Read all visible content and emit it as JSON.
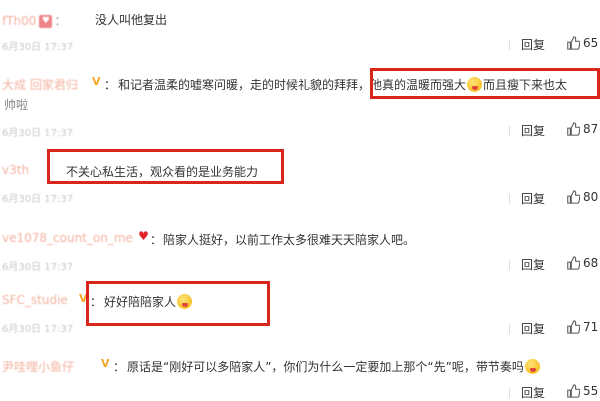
{
  "comments": [
    {
      "username": "fTh00",
      "badge": "♥",
      "text": "没人叫他复出",
      "timestamp": "6月30日 17:37",
      "reply_label": "回复",
      "likes": "65"
    },
    {
      "username": "大成 回家君归",
      "badge": "V",
      "text": "和记者温柔的嘘寒问暖，走的时候礼貌的拜拜，他真的温暖而强大",
      "text_after": "而且瘦下来也太",
      "text_line2": "帅啦",
      "timestamp": "6月30日 17:37",
      "reply_label": "回复",
      "likes": "87"
    },
    {
      "username": "v3th",
      "badge": "",
      "text": "不关心私生活，观众看的是业务能力",
      "timestamp": "6月30日 17:37",
      "reply_label": "回复",
      "likes": "80"
    },
    {
      "username": "ve1078_count_on_me",
      "badge": "♥",
      "text": "陪家人挺好，以前工作太多很难天天陪家人吧。",
      "timestamp": "6月30日 17:37",
      "reply_label": "回复",
      "likes": "68"
    },
    {
      "username": "SFC_studie",
      "badge": "V",
      "text": "好好陪陪家人",
      "timestamp": "6月30日 17:37",
      "reply_label": "回复",
      "likes": "71"
    },
    {
      "username": "尹哇哩小鱼仔",
      "badge": "V",
      "text": "原话是“刚好可以多陪家人”，你们为什么一定要加上那个“先”呢，带节奏吗",
      "timestamp": "",
      "reply_label": "回复",
      "likes": "55"
    }
  ],
  "colors": {
    "highlight": "#d9261c",
    "username": "#eb7350",
    "vip_badge": "#f5a623"
  },
  "icons": {
    "like": "thumbs-up-icon",
    "emoji": "tongue-out-emoji-icon"
  }
}
